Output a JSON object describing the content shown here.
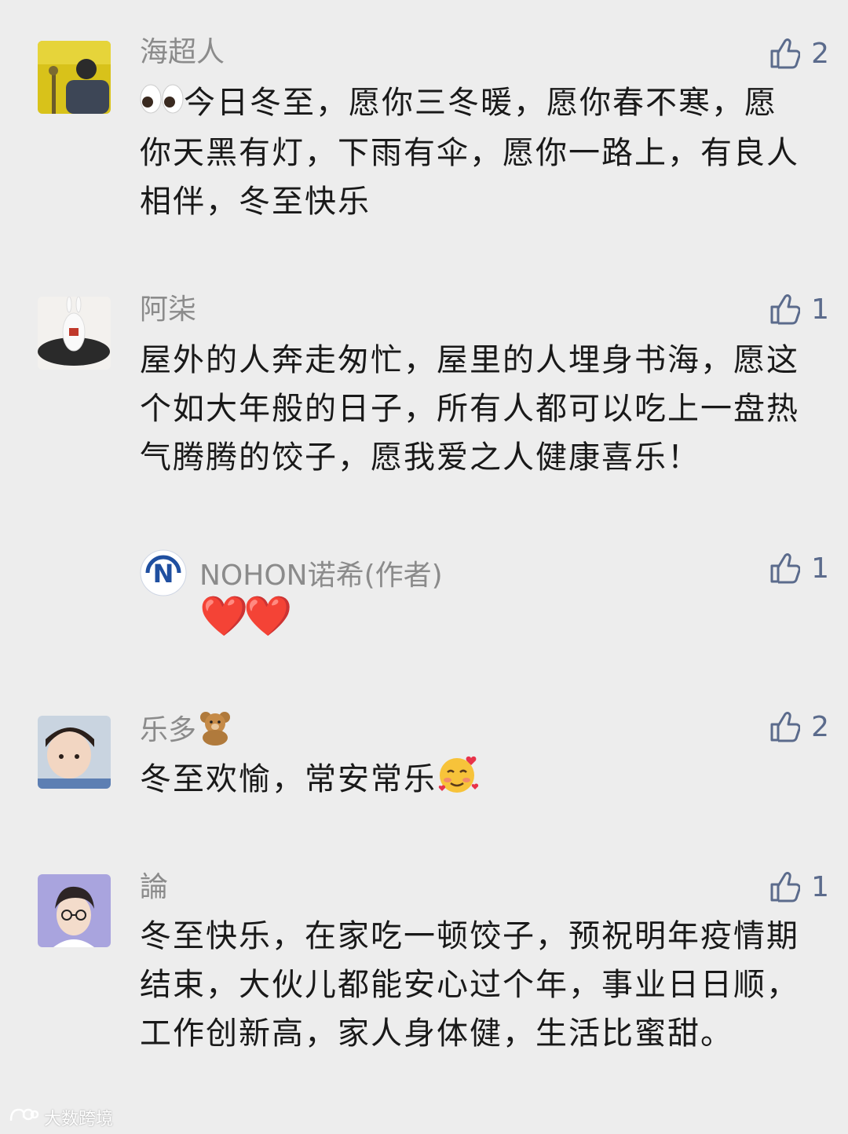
{
  "comments": [
    {
      "name": "海超人",
      "likes": "2",
      "text": "今日冬至，愿你三冬暖，愿你春不寒，愿你天黑有灯，下雨有伞，愿你一路上，有良人相伴，冬至快乐"
    },
    {
      "name": "阿柒",
      "likes": "1",
      "text": "屋外的人奔走匆忙，屋里的人埋身书海，愿这个如大年般的日子，所有人都可以吃上一盘热气腾腾的饺子，愿我爱之人健康喜乐！",
      "reply": {
        "name": "NOHON诺希(作者)",
        "likes": "1",
        "text": "❤️❤️"
      }
    },
    {
      "name": "乐多",
      "name_emoji": "teddy-bear-icon",
      "likes": "2",
      "text": "冬至欢愉，常安常乐",
      "text_emoji": "smiling-face-with-hearts-icon"
    },
    {
      "name": "論",
      "likes": "1",
      "text": "冬至快乐，在家吃一顿饺子，预祝明年疫情期结束，大伙儿都能安心过个年，事业日日顺，工作创新高，家人身体健，生活比蜜甜。"
    }
  ],
  "watermark": {
    "text": "大数跨境"
  },
  "colors": {
    "background": "#ededed",
    "name": "#8b8b8b",
    "text": "#191919",
    "like": "#5b6b8c",
    "heart": "#ff4b6e"
  }
}
